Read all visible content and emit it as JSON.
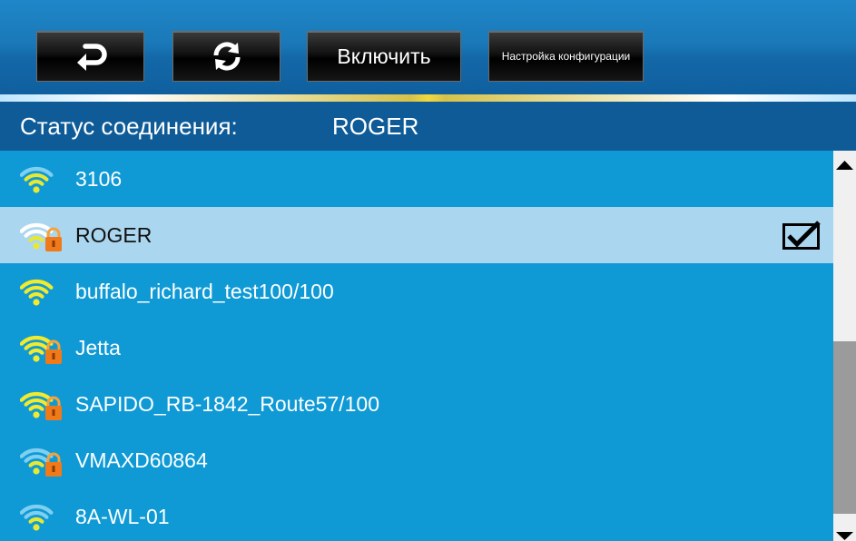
{
  "toolbar": {
    "back_icon": "back-arrow-icon",
    "refresh_icon": "refresh-icon",
    "enable_label": "Включить",
    "config_label": "Настройка конфигурации"
  },
  "status": {
    "label": "Статус соединения:",
    "value": "ROGER"
  },
  "networks": [
    {
      "ssid": "3106",
      "signal_level": 3,
      "secured": false,
      "signal_color": "#e8e832",
      "selected": false
    },
    {
      "ssid": "ROGER",
      "signal_level": 2,
      "secured": true,
      "signal_color": "#e8e832",
      "selected": true,
      "checked": true
    },
    {
      "ssid": "buffalo_richard_test100/100",
      "signal_level": 4,
      "secured": false,
      "signal_color": "#f2ea2c",
      "selected": false
    },
    {
      "ssid": "Jetta",
      "signal_level": 4,
      "secured": true,
      "signal_color": "#f2ea2c",
      "selected": false
    },
    {
      "ssid": "SAPIDO_RB-1842_Route57/100",
      "signal_level": 4,
      "secured": true,
      "signal_color": "#f2ea2c",
      "selected": false
    },
    {
      "ssid": "VMAXD60864",
      "signal_level": 2,
      "secured": true,
      "signal_color": "#e8e832",
      "selected": false
    },
    {
      "ssid": "8A-WL-01",
      "signal_level": 2,
      "secured": false,
      "signal_color": "#e8e832",
      "selected": false
    }
  ],
  "colors": {
    "list_bg": "#0f9ad6",
    "selected_bg": "#abd6ef",
    "status_bg": "#0f5b98",
    "lock": "#f07a1a"
  }
}
